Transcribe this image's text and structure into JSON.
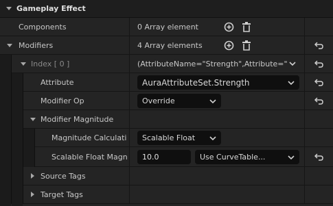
{
  "section": {
    "title": "Gameplay Effect"
  },
  "rows": {
    "components": {
      "label": "Components",
      "value": "0 Array element"
    },
    "modifiers": {
      "label": "Modifiers",
      "value": "4 Array elements"
    },
    "index0": {
      "label": "Index [ 0 ]",
      "value": "(AttributeName=\"Strength\",Attribute=\"/S"
    },
    "attribute": {
      "label": "Attribute",
      "value": "AuraAttributeSet.Strength"
    },
    "modifier_op": {
      "label": "Modifier Op",
      "value": "Override"
    },
    "modifier_magnitude": {
      "label": "Modifier Magnitude"
    },
    "magnitude_calc": {
      "label": "Magnitude Calculati...",
      "value": "Scalable Float"
    },
    "scalable_float": {
      "label": "Scalable Float Magni...",
      "value": "10.0",
      "curve": "Use CurveTable..."
    },
    "source_tags": {
      "label": "Source Tags"
    },
    "target_tags": {
      "label": "Target Tags"
    }
  },
  "icons": {
    "add": "add-circle-icon",
    "delete": "trash-icon",
    "reset": "reset-arrow-icon",
    "expand": "chevron-icon"
  }
}
